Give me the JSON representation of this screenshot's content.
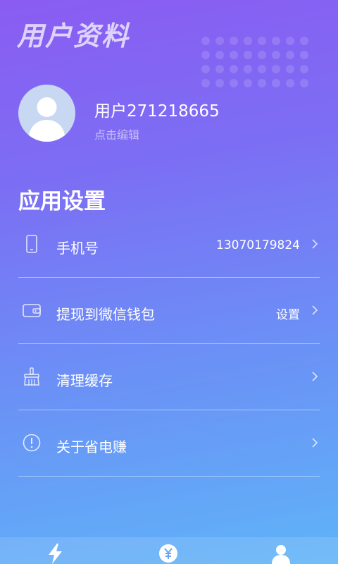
{
  "header": {
    "title": "用户资料"
  },
  "profile": {
    "username": "用户271218665",
    "edit_hint": "点击编辑"
  },
  "section": {
    "title": "应用设置"
  },
  "settings": {
    "items": [
      {
        "label": "手机号",
        "value": "13070179824",
        "icon": "phone-icon"
      },
      {
        "label": "提现到微信钱包",
        "value": "设置",
        "icon": "wallet-icon"
      },
      {
        "label": "清理缓存",
        "value": "",
        "icon": "broom-icon"
      },
      {
        "label": "关于省电赚",
        "value": "",
        "icon": "info-icon"
      }
    ]
  },
  "tabbar": {
    "tabs": [
      {
        "icon": "lightning-icon",
        "active": false
      },
      {
        "icon": "yuan-coin-icon",
        "active": false
      },
      {
        "icon": "user-icon",
        "active": true
      }
    ]
  },
  "colors": {
    "gradient_top": "#8a5cf2",
    "gradient_bottom": "#5fb4f8",
    "avatar_bg": "#c8d8f2"
  }
}
